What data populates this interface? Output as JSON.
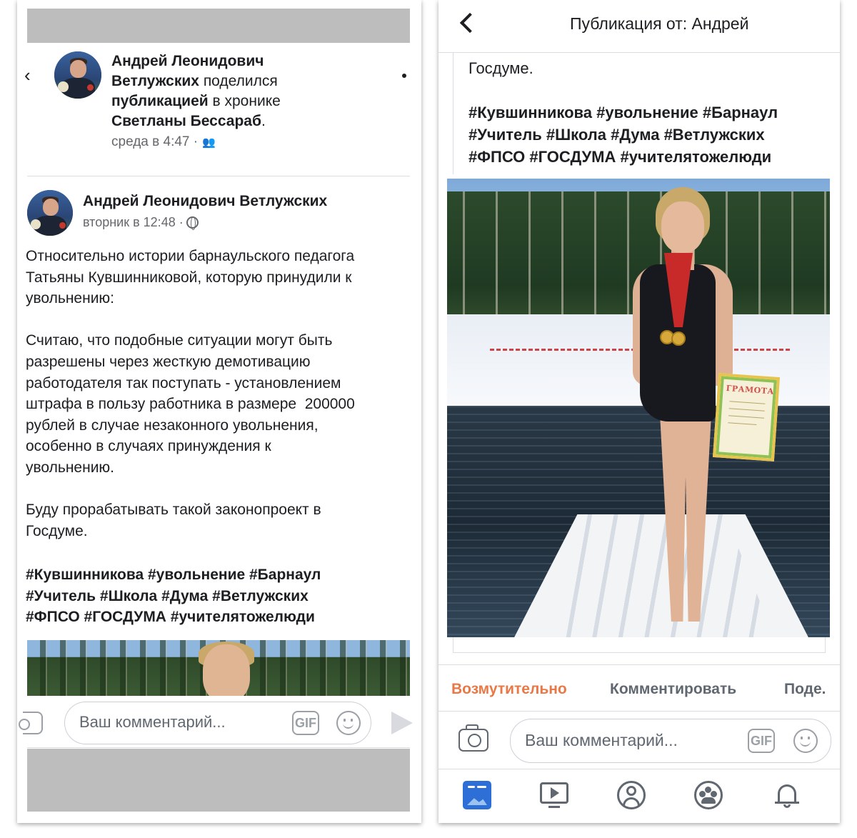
{
  "left_screen": {
    "share_header": {
      "actor": "Андрей Леонидович Ветлужских",
      "actor_line1": "Андрей Леонидович",
      "actor_line2": "Ветлужских",
      "verb": "поделился",
      "object": "публикацией",
      "location_text": "в хронике",
      "target": "Светланы Бессараб",
      "target_suffix": ".",
      "time": "среда в 4:47 ·",
      "privacy_icon": "friends-icon"
    },
    "post": {
      "author": "Андрей Леонидович Ветлужских",
      "time": "вторник в 12:48 ·",
      "privacy_icon": "globe-icon",
      "body": "Относительно истории барнаульского педагога\nТатьяны Кувшинниковой, которую принудили к\nувольнению:\n\nСчитаю, что подобные ситуации могут быть\nразрешены через жесткую демотивацию\nработодателя так поступать - установлением\nштрафа в пользу работника в размере  200000\nрублей в случае незаконного увольнения,\nособенно в случаях принуждения к\nувольнению.\n\nБуду прорабатывать такой законопроект в\nГосдуме.",
      "hashtags": "#Кувшинникова #увольнение #Барнаул\n#Учитель #Школа #Дума #Ветлужских\n#ФПСО #ГОСДУМА #учителятожелюди"
    },
    "comment_bar": {
      "placeholder": "Ваш комментарий...",
      "gif_label": "GIF",
      "camera_icon": "camera-icon",
      "emoji_icon": "smile-icon",
      "send_icon": "send-icon"
    }
  },
  "right_screen": {
    "topbar": {
      "back_icon": "chevron-left-icon",
      "title": "Публикация от: Андрей"
    },
    "text_tail": "Госдуме.",
    "hashtags": "#Кувшинникова #увольнение #Барнаул\n#Учитель #Школа #Дума #Ветлужских\n#ФПСО #ГОСДУМА #учителятожелюди",
    "photo": {
      "diploma_text": "ГРАМОТА"
    },
    "actions": {
      "react": "Возмутительно",
      "comment": "Комментировать",
      "share": "Поде."
    },
    "comment_bar": {
      "placeholder": "Ваш комментарий...",
      "gif_label": "GIF",
      "camera_icon": "camera-icon",
      "emoji_icon": "smile-icon"
    },
    "tabbar": {
      "items": [
        "news-feed-icon",
        "video-icon",
        "profile-icon",
        "groups-icon",
        "notifications-bell-icon"
      ]
    }
  },
  "colors": {
    "reaction_active": "#e97846",
    "text_primary": "#1c1e21",
    "text_secondary": "#65676b",
    "tab_active": "#2d6fd6",
    "redaction": "#bdbdbd"
  }
}
